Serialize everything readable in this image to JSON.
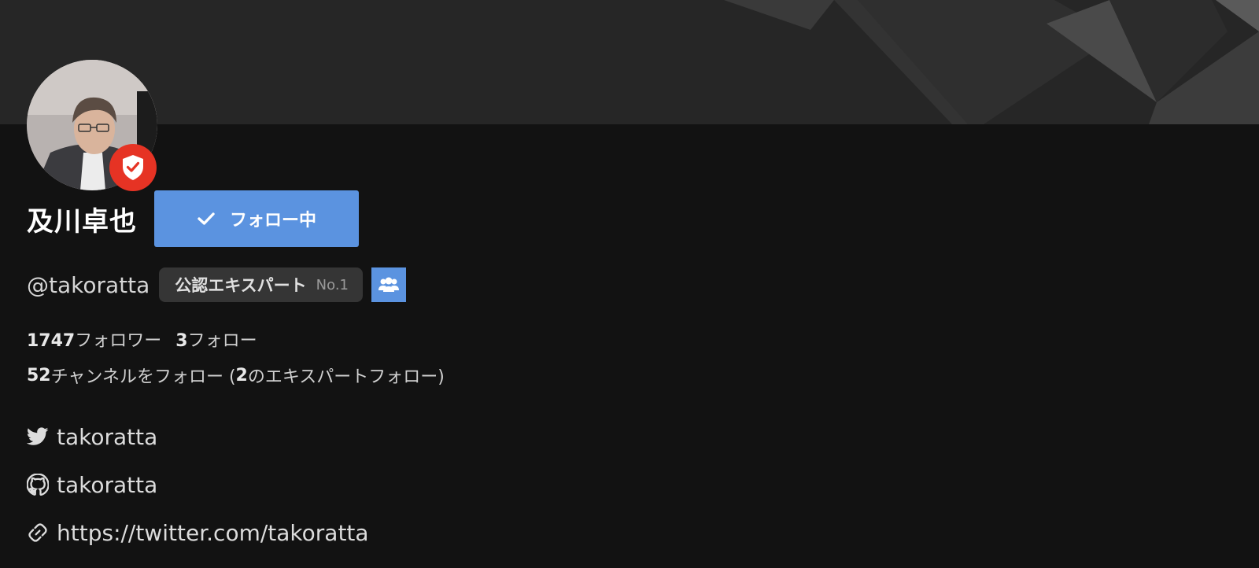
{
  "profile": {
    "name": "及川卓也",
    "handle": "@takoratta",
    "follow_button_label": "フォロー中",
    "expert_badge": {
      "label": "公認エキスパート",
      "rank": "No.1"
    }
  },
  "stats": {
    "followers_count": "1747",
    "followers_label": "フォロワー",
    "following_count": "3",
    "following_label": "フォロー",
    "channels_count": "52",
    "channels_label": "チャンネルをフォロー (",
    "experts_count": "2",
    "experts_label": "のエキスパートフォロー)"
  },
  "links": {
    "twitter": "takoratta",
    "github": "takoratta",
    "website": "https://twitter.com/takoratta"
  },
  "colors": {
    "accent": "#5b93e0",
    "badge_red": "#e63324",
    "background": "#121212",
    "banner": "#262626"
  },
  "icons": {
    "verified": "shield-check-icon",
    "follow_check": "check-icon",
    "group": "users-icon",
    "twitter": "twitter-icon",
    "github": "github-icon",
    "link": "link-icon"
  }
}
